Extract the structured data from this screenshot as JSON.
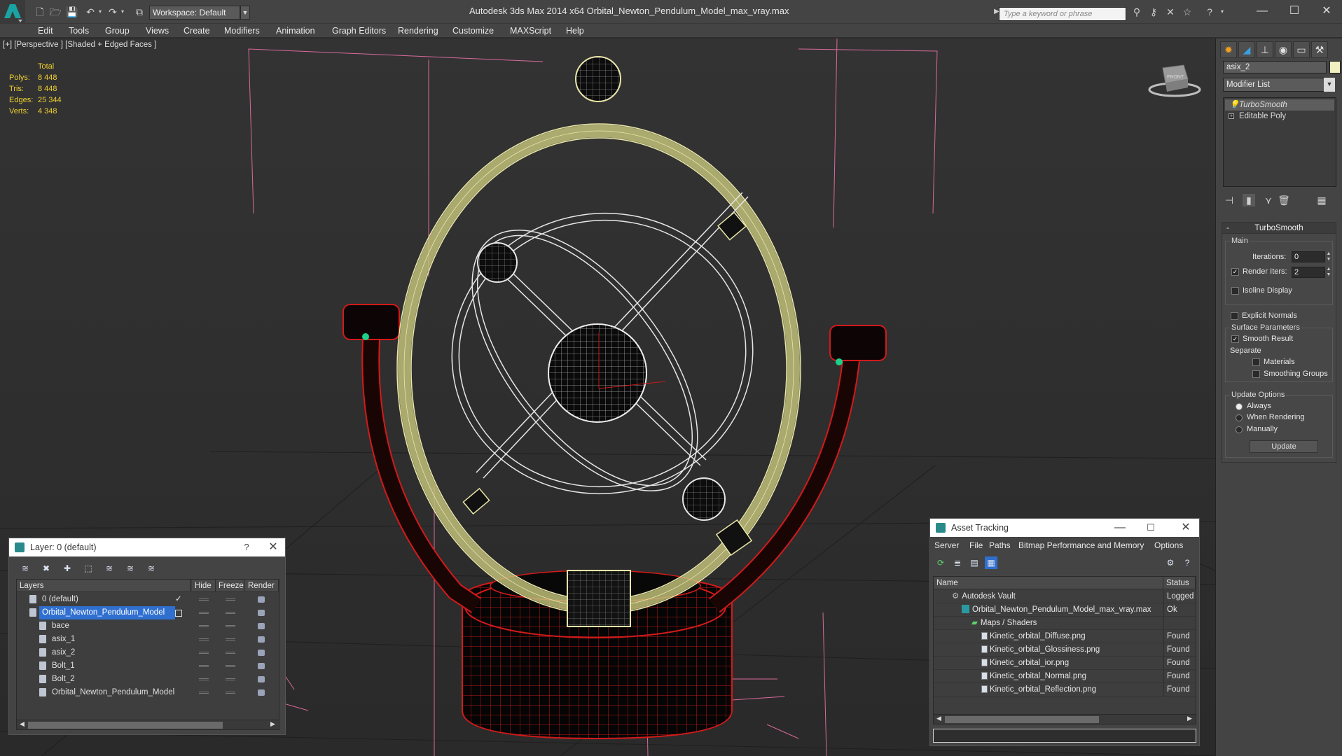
{
  "app": {
    "title": "Autodesk 3ds Max  2014 x64     Orbital_Newton_Pendulum_Model_max_vray.max",
    "workspace": "Workspace: Default",
    "search_placeholder": "Type a keyword or phrase"
  },
  "menu": [
    "Edit",
    "Tools",
    "Group",
    "Views",
    "Create",
    "Modifiers",
    "Animation",
    "Graph Editors",
    "Rendering",
    "Customize",
    "MAXScript",
    "Help"
  ],
  "viewport": {
    "label": "[+] [Perspective ] [Shaded + Edged Faces ]",
    "stats_header": "Total",
    "stats": [
      {
        "label": "Polys:",
        "value": "8 448"
      },
      {
        "label": "Tris:",
        "value": "8 448"
      },
      {
        "label": "Edges:",
        "value": "25 344"
      },
      {
        "label": "Verts:",
        "value": "4 348"
      }
    ],
    "viewcube_label": "FRONT"
  },
  "command_panel": {
    "object_name": "asix_2",
    "object_color": "#f0f0c0",
    "modifier_list": "Modifier List",
    "stack": [
      "TurboSmooth",
      "Editable Poly"
    ],
    "rollout_title": "TurboSmooth",
    "main_group": "Main",
    "iterations_label": "Iterations:",
    "iterations_value": "0",
    "render_iters_label": "Render Iters:",
    "render_iters_value": "2",
    "render_iters_checked": true,
    "isoline_label": "Isoline Display",
    "explicit_normals_label": "Explicit Normals",
    "surface_group": "Surface Parameters",
    "smooth_result_label": "Smooth Result",
    "separate_label": "Separate",
    "materials_label": "Materials",
    "smoothing_groups_label": "Smoothing Groups",
    "update_group": "Update Options",
    "always_label": "Always",
    "when_rendering_label": "When Rendering",
    "manually_label": "Manually",
    "update_button": "Update"
  },
  "layer_window": {
    "title": "Layer: 0 (default)",
    "help": "?",
    "columns": [
      "Layers",
      "Hide",
      "Freeze",
      "Render"
    ],
    "rows": [
      {
        "name": "0 (default)",
        "level": 0,
        "checked": true
      },
      {
        "name": "Orbital_Newton_Pendulum_Model",
        "level": 0,
        "selected": true
      },
      {
        "name": "bace",
        "level": 1
      },
      {
        "name": "asix_1",
        "level": 1
      },
      {
        "name": "asix_2",
        "level": 1
      },
      {
        "name": "Bolt_1",
        "level": 1
      },
      {
        "name": "Bolt_2",
        "level": 1
      },
      {
        "name": "Orbital_Newton_Pendulum_Model",
        "level": 1
      }
    ]
  },
  "asset_window": {
    "title": "Asset Tracking",
    "menu": [
      "Server",
      "File",
      "Paths",
      "Bitmap Performance and Memory",
      "Options"
    ],
    "columns": [
      "Name",
      "Status"
    ],
    "rows": [
      {
        "name": "Autodesk Vault",
        "status": "Logged",
        "level": 1
      },
      {
        "name": "Orbital_Newton_Pendulum_Model_max_vray.max",
        "status": "Ok",
        "level": 2
      },
      {
        "name": "Maps / Shaders",
        "status": "",
        "level": 3
      },
      {
        "name": "Kinetic_orbital_Diffuse.png",
        "status": "Found",
        "level": 4
      },
      {
        "name": "Kinetic_orbital_Glossiness.png",
        "status": "Found",
        "level": 4
      },
      {
        "name": "Kinetic_orbital_ior.png",
        "status": "Found",
        "level": 4
      },
      {
        "name": "Kinetic_orbital_Normal.png",
        "status": "Found",
        "level": 4
      },
      {
        "name": "Kinetic_orbital_Reflection.png",
        "status": "Found",
        "level": 4
      }
    ]
  }
}
